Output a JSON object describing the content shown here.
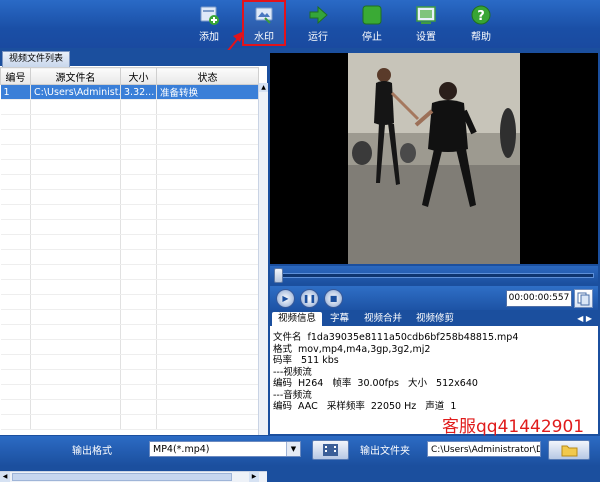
{
  "toolbar": {
    "add": "添加",
    "watermark": "水印",
    "run": "运行",
    "stop": "停止",
    "settings": "设置",
    "help": "帮助"
  },
  "left_panel": {
    "tab": "视频文件列表",
    "columns": [
      "编号",
      "源文件名",
      "大小",
      "状态"
    ],
    "rows": [
      {
        "num": "1",
        "file": "C:\\Users\\Administ...",
        "size": "3.32...",
        "status": "准备转换"
      }
    ]
  },
  "player": {
    "time": "00:00:00:557"
  },
  "info_tabs": [
    "视频信息",
    "字幕",
    "视频合并",
    "视频修剪"
  ],
  "info": {
    "line1": "文件名  f1da39035e8111a50cdb6bf258b48815.mp4",
    "line2": "格式  mov,mp4,m4a,3gp,3g2,mj2",
    "line3": "码率   511 kbs",
    "line4": "---视频流",
    "line5": "编码  H264   帧率  30.00fps   大小   512x640",
    "line6": "---音频流",
    "line7": "编码  AAC   采样频率  22050 Hz   声道  1"
  },
  "contact": "客服qq41442901",
  "bottom": {
    "output_format_label": "输出格式",
    "output_format_value": "MP4(*.mp4)",
    "output_folder_label": "输出文件夹",
    "output_folder_value": "C:\\Users\\Administrator\\Des"
  },
  "colors": {
    "accent": "#1b4f9e",
    "selected_row": "#3a7fd8",
    "highlight": "#e3131b"
  },
  "icons": [
    "add-file-icon",
    "watermark-icon",
    "run-arrow-icon",
    "stop-icon",
    "settings-icon",
    "help-icon",
    "play-icon",
    "pause-icon",
    "stop-small-icon",
    "copy-icon",
    "film-icon",
    "folder-icon"
  ]
}
